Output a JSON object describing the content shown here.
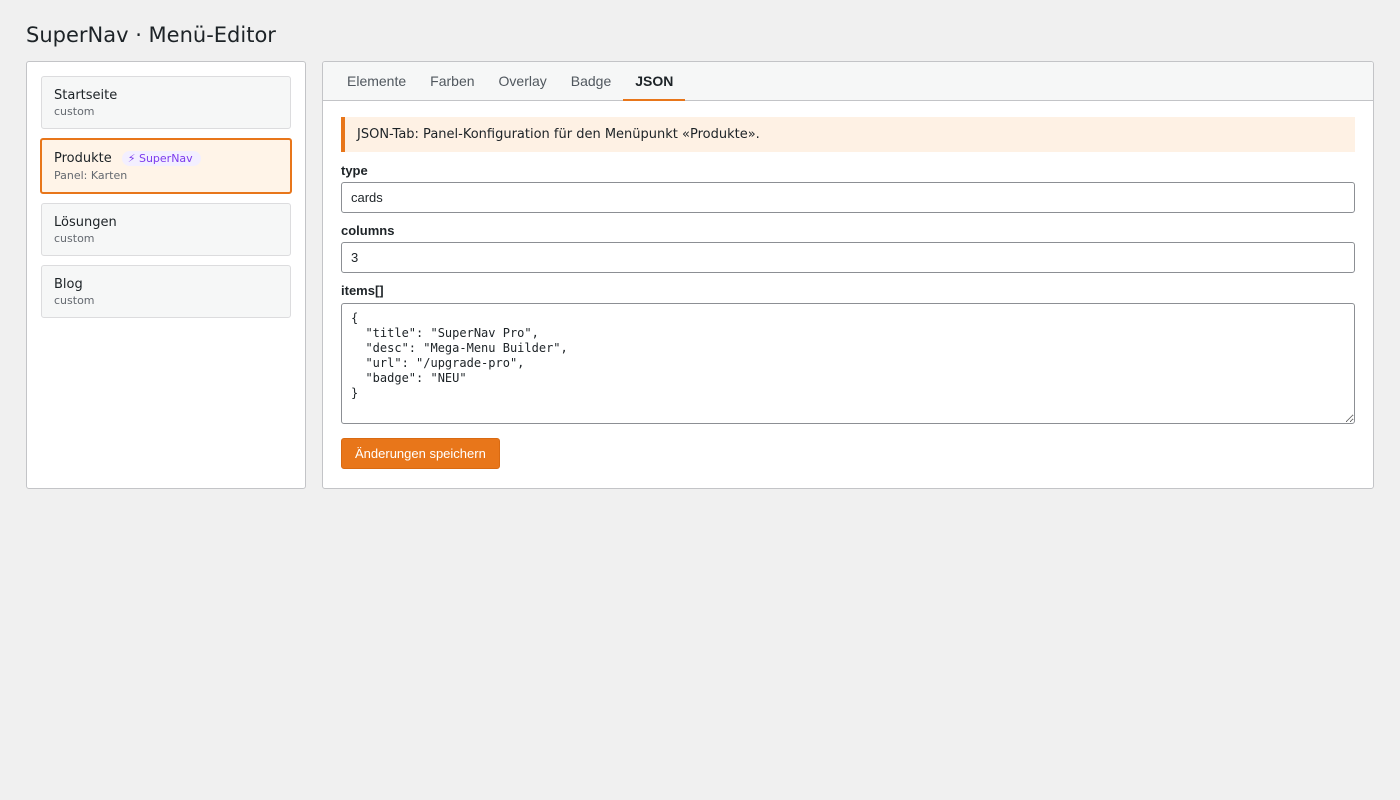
{
  "app": {
    "title": "SuperNav · Menü-Editor"
  },
  "sidebar": {
    "items": [
      {
        "label": "Startseite",
        "sub": "custom"
      },
      {
        "label": "Produkte",
        "badge": "⚡ SuperNav",
        "sub": "Panel: Karten",
        "active": true
      },
      {
        "label": "Lösungen",
        "sub": "custom"
      },
      {
        "label": "Blog",
        "sub": "custom"
      }
    ]
  },
  "tabs": [
    {
      "label": "Elemente"
    },
    {
      "label": "Farben"
    },
    {
      "label": "Overlay"
    },
    {
      "label": "Badge"
    },
    {
      "label": "JSON",
      "active": true
    }
  ],
  "notice": "JSON-Tab: Panel-Konfiguration für den Menüpunkt «Produkte».",
  "fields": {
    "type": {
      "label": "type",
      "value": "cards"
    },
    "columns": {
      "label": "columns",
      "value": "3"
    },
    "items": {
      "label": "items[]",
      "value": "{\n  \"title\": \"SuperNav Pro\",\n  \"desc\": \"Mega-Menu Builder\",\n  \"url\": \"/upgrade-pro\",\n  \"badge\": \"NEU\"\n}"
    }
  },
  "save_button": "Änderungen speichern",
  "colors": {
    "accent": "#e8761a",
    "badge": "#7c3aed",
    "background": "#f0f0f0"
  }
}
